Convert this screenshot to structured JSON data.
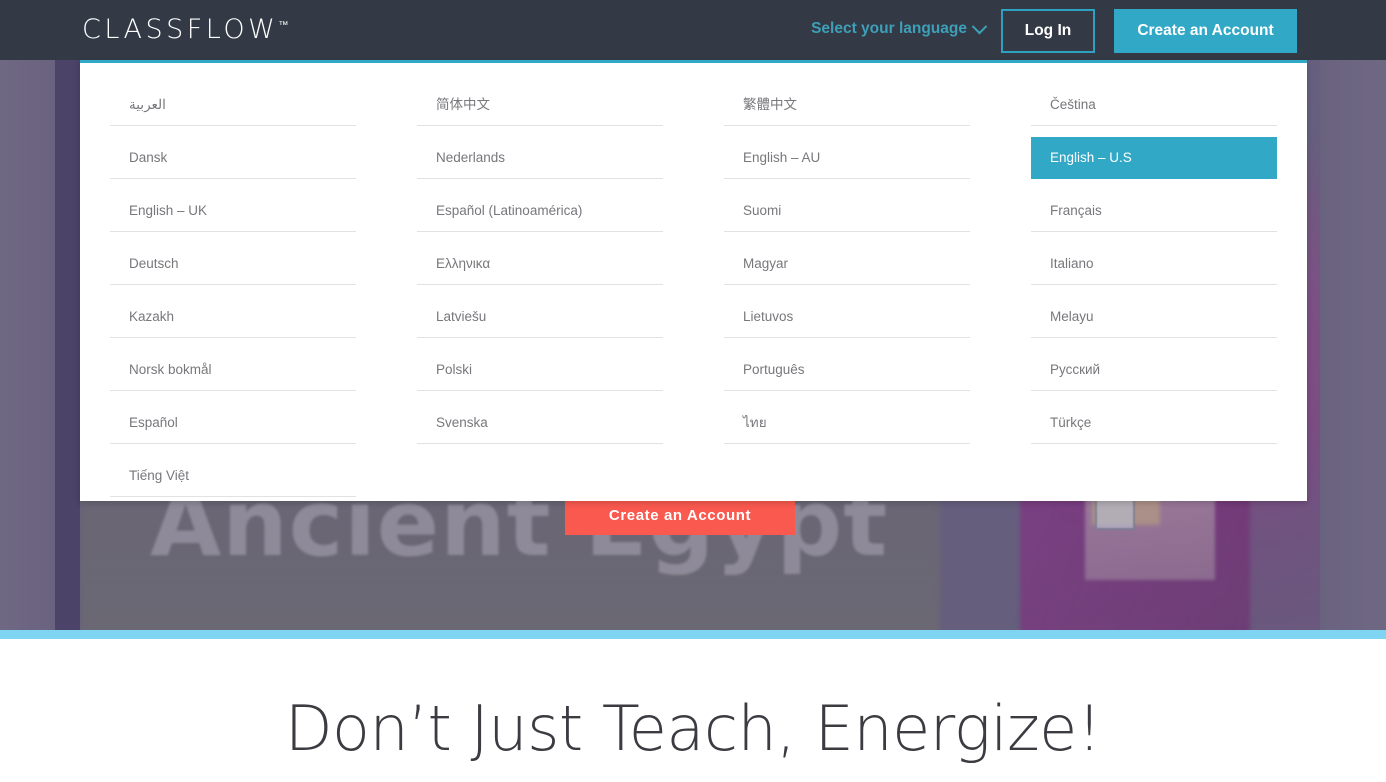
{
  "header": {
    "logo_text": "CLASSFLOW",
    "logo_tm": "™",
    "language_trigger": "Select your language",
    "chevron_icon": "chevron-down-icon",
    "login_label": "Log In",
    "create_account_label": "Create an Account",
    "background_color": "#343a45",
    "accent_color": "#31a8c6",
    "link_color": "#3d9fb8"
  },
  "language_menu": {
    "selected": "English – U.S",
    "highlight_color": "#31a8c6",
    "top_border_color": "#31a8c6",
    "columns": [
      {
        "items": [
          "العربية",
          "Dansk",
          "English – UK",
          "Deutsch",
          "Kazakh",
          "Norsk bokmål",
          "Español",
          "Tiếng Việt"
        ]
      },
      {
        "items": [
          "简体中文",
          "Nederlands",
          "Español (Latinoamérica)",
          "Ελληνικα",
          "Latviešu",
          "Polski",
          "Svenska"
        ]
      },
      {
        "items": [
          "繁體中文",
          "English – AU",
          "Suomi",
          "Magyar",
          "Lietuvos",
          "Português",
          "ไทย"
        ]
      },
      {
        "items": [
          "Čeština",
          "English – U.S",
          "Français",
          "Italiano",
          "Melayu",
          "Русский",
          "Türkçe"
        ]
      }
    ]
  },
  "hero": {
    "sign_text": "Ancient Egypt",
    "cta_label": "Create an Account",
    "cta_color": "#f9594e",
    "band_color": "#7fd4f2"
  },
  "section_below": {
    "headline": "Don’t Just Teach, Energize!"
  }
}
